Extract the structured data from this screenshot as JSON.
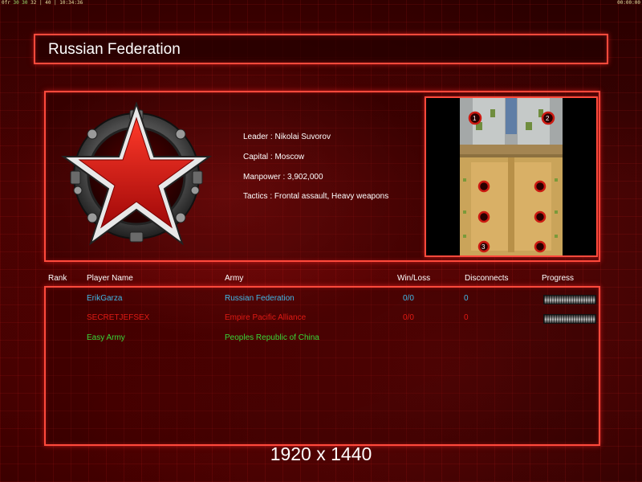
{
  "top_bar": {
    "left_counter": "0fr",
    "left_fps": "30 30",
    "left_extra": "32 | 40 |",
    "left_time": "10:34:36",
    "right_time": "00:00:00"
  },
  "title": "Russian Federation",
  "faction": {
    "leader": "Leader : Nikolai Suvorov",
    "capital": "Capital : Moscow",
    "manpower": "Manpower : 3,902,000",
    "tactics": "Tactics : Frontal assault, Heavy weapons"
  },
  "minimap": {
    "start_labels": [
      "1",
      "2",
      "3"
    ]
  },
  "table": {
    "headers": {
      "rank": "Rank",
      "player": "Player Name",
      "army": "Army",
      "winloss": "Win/Loss",
      "disconnects": "Disconnects",
      "progress": "Progress"
    },
    "rows": [
      {
        "player": "ErikGarza",
        "army": "Russian Federation",
        "winloss": "0/0",
        "disconnects": "0",
        "color": "#41b8e6",
        "progress": 1.0
      },
      {
        "player": "SECRETJEFSEX",
        "army": "Empire Pacific Alliance",
        "winloss": "0/0",
        "disconnects": "0",
        "color": "#e01a14",
        "progress": 1.0
      },
      {
        "player": "Easy Army",
        "army": "Peoples Republic of China",
        "winloss": "",
        "disconnects": "",
        "color": "#38d838"
      }
    ]
  },
  "resolution_text": "1920 x 1440",
  "colors": {
    "frame": "#ff4a3c",
    "background": "#3a0303"
  }
}
